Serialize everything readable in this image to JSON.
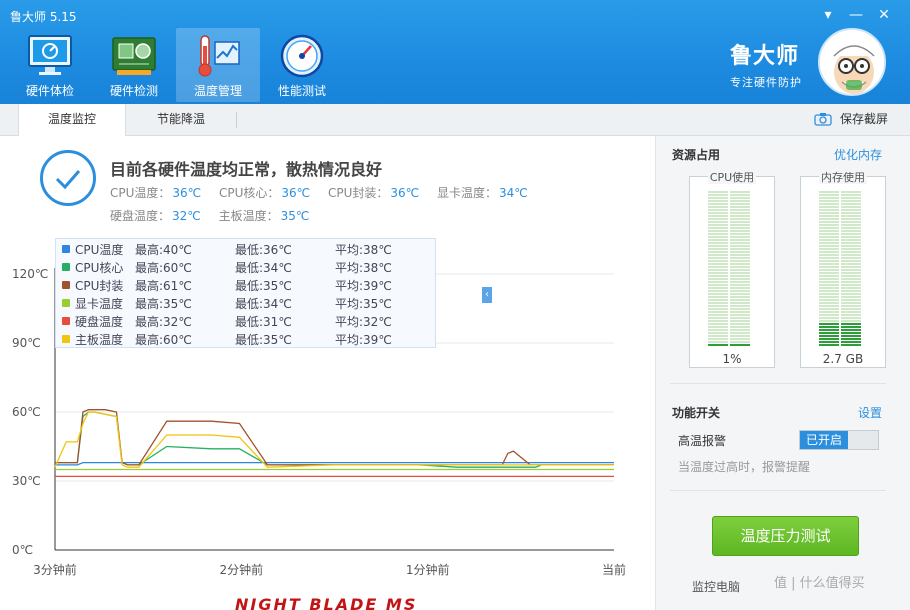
{
  "app": {
    "title": "鲁大师 5.15"
  },
  "window_controls": {
    "menu": "▾",
    "minimize": "—",
    "close": "✕"
  },
  "nav": [
    {
      "label": "硬件体检",
      "icon": "monitor-icon"
    },
    {
      "label": "硬件检测",
      "icon": "circuit-board-icon"
    },
    {
      "label": "温度管理",
      "icon": "thermometer-icon",
      "active": true
    },
    {
      "label": "性能测试",
      "icon": "speedometer-icon"
    }
  ],
  "brand": {
    "name": "鲁大师",
    "slogan": "专注硬件防护"
  },
  "tabs": {
    "monitor": "温度监控",
    "cooling": "节能降温"
  },
  "toolbar": {
    "save_screenshot": "保存截屏"
  },
  "status": {
    "title": "目前各硬件温度均正常，散热情况良好",
    "line1": [
      {
        "label": "CPU温度：",
        "value": "36℃"
      },
      {
        "label": "CPU核心：",
        "value": "36℃"
      },
      {
        "label": "CPU封装：",
        "value": "36℃"
      },
      {
        "label": "显卡温度：",
        "value": "34℃"
      }
    ],
    "line2": [
      {
        "label": "硬盘温度：",
        "value": "32℃"
      },
      {
        "label": "主板温度：",
        "value": "35℃"
      }
    ]
  },
  "legend": [
    {
      "name": "CPU温度",
      "max": "最高:40℃",
      "min": "最低:36℃",
      "avg": "平均:38℃",
      "color": "#2e86de"
    },
    {
      "name": "CPU核心",
      "max": "最高:60℃",
      "min": "最低:34℃",
      "avg": "平均:38℃",
      "color": "#27ae60"
    },
    {
      "name": "CPU封装",
      "max": "最高:61℃",
      "min": "最低:35℃",
      "avg": "平均:39℃",
      "color": "#a0522d"
    },
    {
      "name": "显卡温度",
      "max": "最高:35℃",
      "min": "最低:34℃",
      "avg": "平均:35℃",
      "color": "#9acd32"
    },
    {
      "name": "硬盘温度",
      "max": "最高:32℃",
      "min": "最低:31℃",
      "avg": "平均:32℃",
      "color": "#e74c3c"
    },
    {
      "name": "主板温度",
      "max": "最高:60℃",
      "min": "最低:35℃",
      "avg": "平均:39℃",
      "color": "#f1c40f"
    }
  ],
  "chart_data": {
    "type": "line",
    "title": "",
    "xlabel": "",
    "ylabel": "",
    "ylim": [
      0,
      120
    ],
    "yticks": [
      "0℃",
      "30℃",
      "60℃",
      "90℃",
      "120℃"
    ],
    "xticks": [
      "3分钟前",
      "2分钟前",
      "1分钟前",
      "当前"
    ],
    "x": [
      0,
      2,
      4,
      5,
      6,
      7,
      9,
      11,
      12,
      13,
      14,
      15,
      20,
      28,
      33,
      38,
      50,
      65,
      72,
      75,
      77,
      78,
      80,
      81,
      82,
      84,
      85,
      86,
      87,
      100
    ],
    "series": [
      {
        "name": "CPU温度",
        "color": "#2e86de",
        "values": [
          37,
          37,
          37,
          38,
          38,
          38,
          38,
          38,
          38,
          38,
          38,
          38,
          38,
          38,
          38,
          38,
          38,
          38,
          38,
          38,
          38,
          38,
          38,
          38,
          38,
          38,
          38,
          38,
          38,
          38
        ]
      },
      {
        "name": "CPU核心",
        "color": "#27ae60",
        "values": [
          38,
          38,
          38,
          58,
          60,
          60,
          59,
          58,
          38,
          37,
          37,
          37,
          45,
          44,
          44,
          37,
          37,
          37,
          36,
          36,
          36,
          36,
          36,
          36,
          36,
          36,
          36,
          36,
          37,
          37
        ]
      },
      {
        "name": "CPU封装",
        "color": "#a0522d",
        "values": [
          38,
          38,
          38,
          60,
          61,
          61,
          61,
          60,
          38,
          37,
          37,
          37,
          56,
          56,
          55,
          37,
          37,
          37,
          37,
          37,
          37,
          37,
          37,
          42,
          43,
          39,
          37,
          37,
          37,
          37
        ]
      },
      {
        "name": "显卡温度",
        "color": "#9acd32",
        "values": [
          35,
          35,
          35,
          35,
          35,
          35,
          35,
          35,
          35,
          35,
          35,
          35,
          35,
          35,
          35,
          35,
          35,
          35,
          35,
          35,
          35,
          35,
          35,
          35,
          35,
          35,
          35,
          35,
          35,
          35
        ]
      },
      {
        "name": "硬盘温度",
        "color": "#e74c3c",
        "values": [
          32,
          32,
          32,
          32,
          32,
          32,
          32,
          32,
          32,
          32,
          32,
          32,
          32,
          32,
          32,
          32,
          32,
          32,
          32,
          32,
          32,
          32,
          32,
          32,
          32,
          32,
          32,
          32,
          32,
          32
        ]
      },
      {
        "name": "主板温度",
        "color": "#f1c40f",
        "values": [
          36,
          47,
          47,
          55,
          60,
          60,
          59,
          58,
          37,
          36,
          36,
          36,
          50,
          50,
          49,
          36,
          37,
          37,
          37,
          37,
          37,
          37,
          37,
          37,
          37,
          37,
          37,
          37,
          37,
          37
        ]
      }
    ]
  },
  "resources": {
    "title": "资源占用",
    "optimize_link": "优化内存",
    "cpu": {
      "label": "CPU使用",
      "value": "1%",
      "fraction": 0.01
    },
    "memory": {
      "label": "内存使用",
      "value": "2.7 GB",
      "fraction": 0.15
    }
  },
  "functions": {
    "title": "功能开关",
    "settings_link": "设置",
    "alarm_label": "高温报警",
    "alarm_state": "已开启",
    "hint": "当温度过高时，报警提醒"
  },
  "stress_button": "温度压力测试",
  "footer": {
    "monitor_text": "监控电脑",
    "watermark": "值 | 什么值得买"
  },
  "bottom_text": "NIGHT BLADE MS"
}
